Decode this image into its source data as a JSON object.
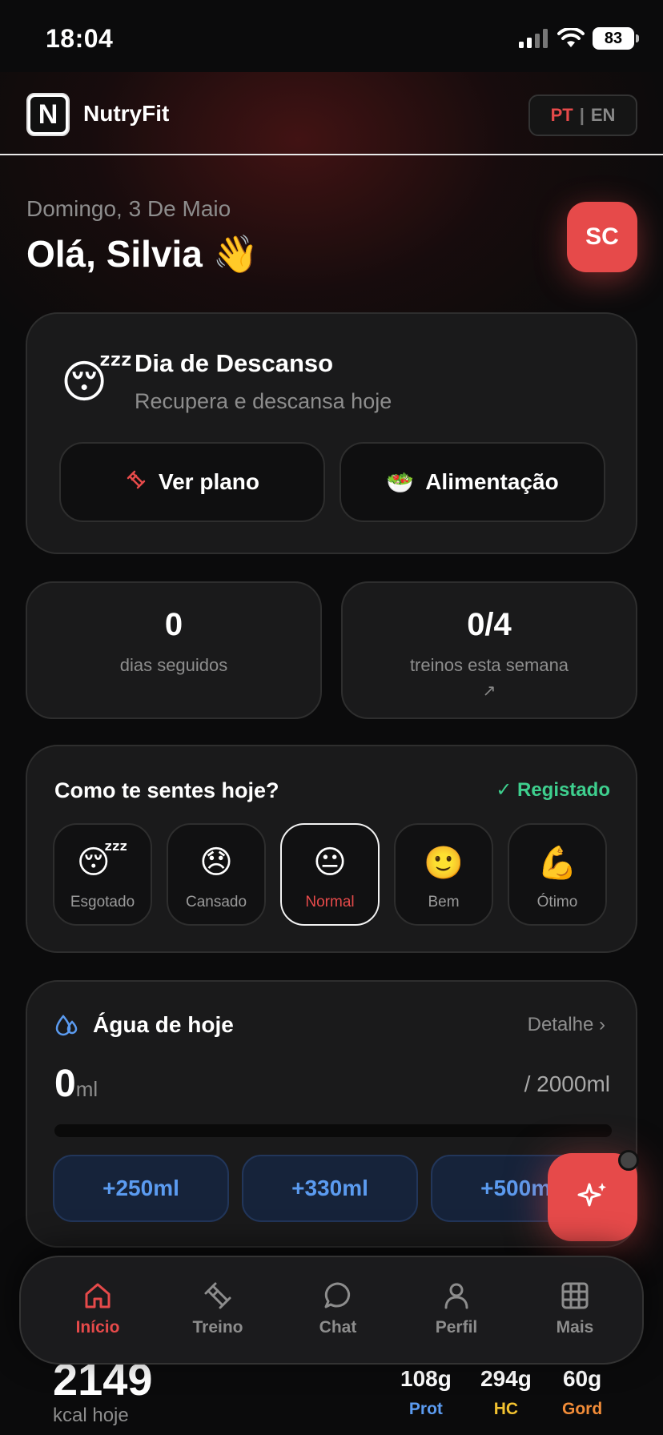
{
  "status_bar": {
    "time": "18:04",
    "battery": "83"
  },
  "header": {
    "brand": "NutryFit",
    "logo_letter": "N",
    "lang_pt": "PT",
    "lang_sep": "|",
    "lang_en": "EN"
  },
  "greeting": {
    "date": "Domingo, 3 De Maio",
    "hello": "Olá, Silvia 👋",
    "initials": "SC"
  },
  "rest_day": {
    "emoji": "😴",
    "title": "Dia de Descanso",
    "subtitle": "Recupera e descansa hoje",
    "plan_icon": "🏋",
    "plan_label": "Ver plano",
    "food_icon": "🥗",
    "food_label": "Alimentação"
  },
  "stats": {
    "streak_value": "0",
    "streak_label": "dias seguidos",
    "workouts_value": "0/4",
    "workouts_label": "treinos esta semana",
    "trend_icon": "↗"
  },
  "mood": {
    "question": "Como te sentes hoje?",
    "status": "✓ Registado",
    "options": [
      {
        "emoji": "😴",
        "label": "Esgotado"
      },
      {
        "emoji": "😞",
        "label": "Cansado"
      },
      {
        "emoji": "😐",
        "label": "Normal"
      },
      {
        "emoji": "🙂",
        "label": "Bem"
      },
      {
        "emoji": "💪",
        "label": "Ótimo"
      }
    ],
    "selected": "Normal"
  },
  "water": {
    "title": "Água de hoje",
    "detail": "Detalhe ›",
    "amount": "0",
    "unit": "ml",
    "goal": "/ 2000ml",
    "progress": 0,
    "buttons": [
      "+250ml",
      "+330ml",
      "+500ml"
    ]
  },
  "calories": {
    "value": "2149",
    "label": "kcal hoje",
    "macros": [
      {
        "value": "108g",
        "name": "Prot",
        "color": "#5b9bf0"
      },
      {
        "value": "294g",
        "name": "HC",
        "color": "#f2c230"
      },
      {
        "value": "60g",
        "name": "Gord",
        "color": "#f28c38"
      }
    ]
  },
  "nav": {
    "items": [
      {
        "label": "Início",
        "icon": "home-icon",
        "active": true
      },
      {
        "label": "Treino",
        "icon": "dumbbell-icon"
      },
      {
        "label": "Chat",
        "icon": "chat-icon"
      },
      {
        "label": "Perfil",
        "icon": "user-icon"
      },
      {
        "label": "Mais",
        "icon": "grid-icon"
      }
    ]
  },
  "colors": {
    "accent": "#e64a4a",
    "success": "#3ecf8e",
    "water": "#5b9bf0",
    "card": "#1a1a1b"
  }
}
